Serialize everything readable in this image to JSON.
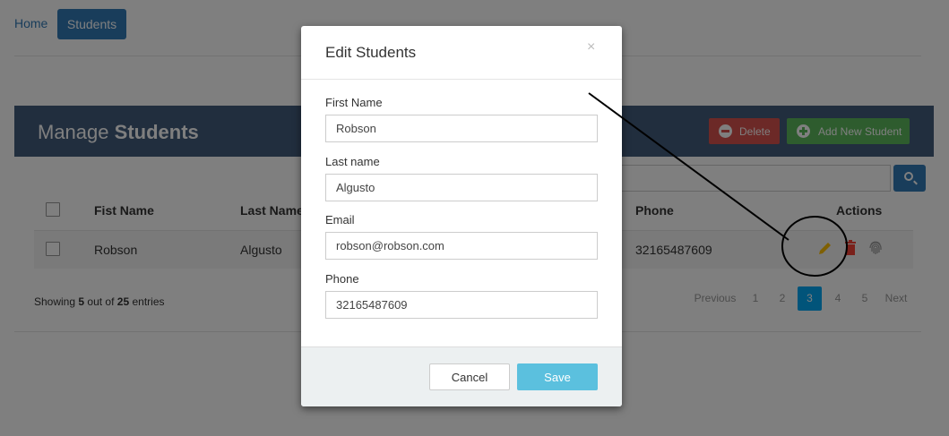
{
  "nav": {
    "home": "Home",
    "students": "Students"
  },
  "header": {
    "title_prefix": "Manage",
    "title_bold": "Students",
    "delete_label": "Delete",
    "add_label": "Add New Student"
  },
  "table": {
    "headers": {
      "first": "Fist Name",
      "last": "Last Name",
      "phone": "Phone",
      "actions": "Actions"
    },
    "rows": [
      {
        "first": "Robson",
        "last": "Algusto",
        "phone": "32165487609"
      }
    ]
  },
  "footer": {
    "showing_prefix": "Showing",
    "shown": "5",
    "middle": "out of",
    "total": "25",
    "suffix": "entries",
    "pagination": {
      "prev": "Previous",
      "pages": [
        "1",
        "2",
        "3",
        "4",
        "5"
      ],
      "next": "Next",
      "active": "3"
    }
  },
  "modal": {
    "title": "Edit Students",
    "close": "×",
    "fields": {
      "first_name": {
        "label": "First Name",
        "value": "Robson"
      },
      "last_name": {
        "label": "Last name",
        "value": "Algusto"
      },
      "email": {
        "label": "Email",
        "value": "robson@robson.com"
      },
      "phone": {
        "label": "Phone",
        "value": "32165487609"
      }
    },
    "cancel": "Cancel",
    "save": "Save"
  },
  "icons": {
    "edit": "pencil-icon",
    "delete": "trash-icon",
    "fingerprint": "fingerprint-icon",
    "search": "search-icon"
  },
  "colors": {
    "banner": "#435d7d",
    "delete": "#d9534f",
    "add": "#5cb85c",
    "primary": "#337ab7",
    "active_page": "#03a9f4",
    "save": "#5bc0de",
    "edit_icon": "#ffc107"
  }
}
